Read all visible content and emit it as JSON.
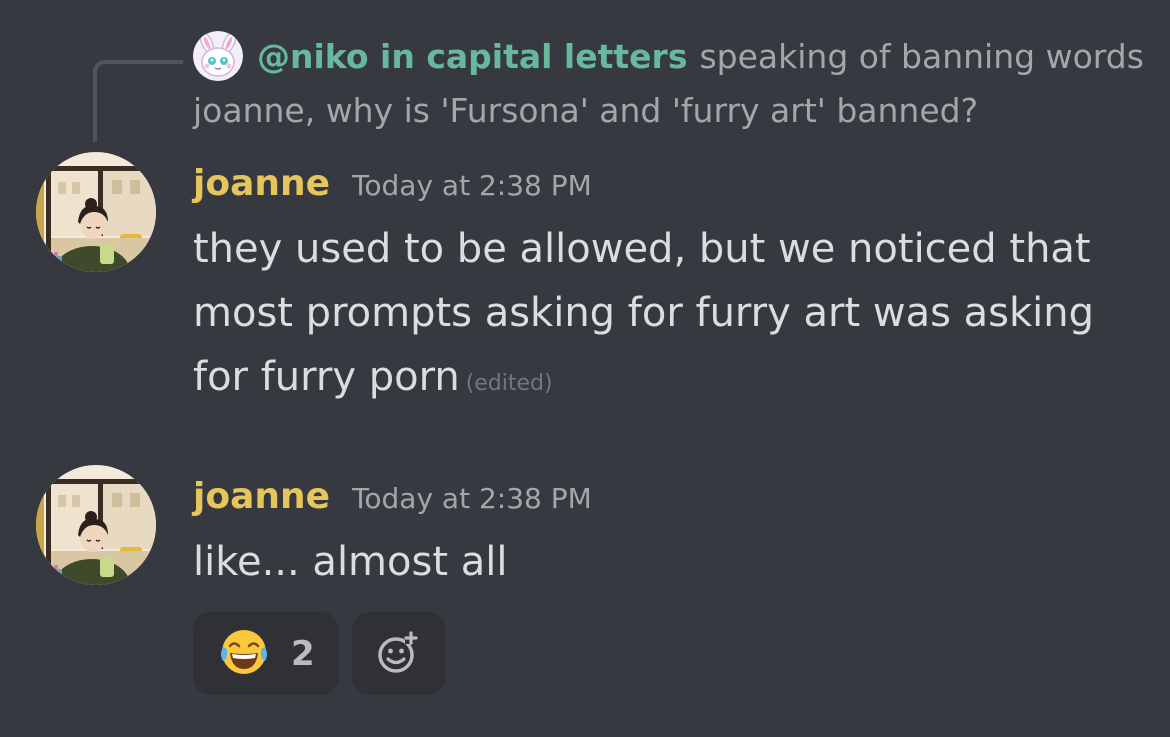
{
  "reply": {
    "author": "@niko in capital letters",
    "text": "speaking of banning words joanne, why is 'Fursona' and 'furry art' banned?"
  },
  "messages": [
    {
      "author": "joanne",
      "timestamp": "Today at 2:38 PM",
      "text": "they used to be allowed, but we noticed that most prompts asking for furry art was asking for furry porn",
      "edited_label": "(edited)"
    },
    {
      "author": "joanne",
      "timestamp": "Today at 2:38 PM",
      "text": "like... almost all"
    }
  ],
  "reactions": [
    {
      "emoji": "😂",
      "count": "2"
    }
  ],
  "icons": {
    "reply_avatar": "bunny-avatar-icon",
    "user_avatar": "woman-with-drink-avatar-icon",
    "add_reaction": "add-reaction-smiley-icon"
  },
  "colors": {
    "background": "#36393f",
    "reply_author": "#67b89c",
    "username": "#e6c55b",
    "message_text": "#dcddde",
    "muted": "#a3a6aa",
    "reaction_bg": "#2f3136"
  }
}
